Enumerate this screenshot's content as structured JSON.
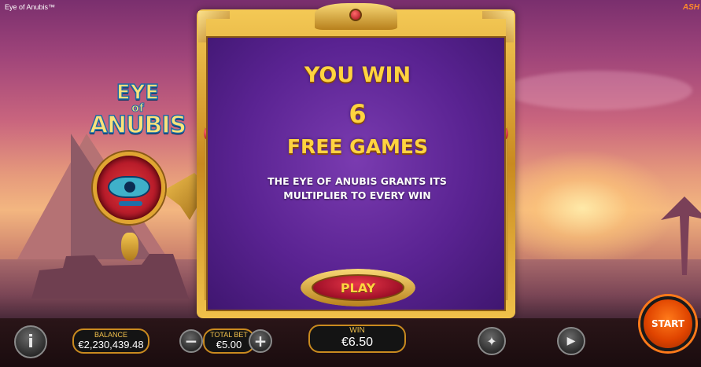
{
  "header": {
    "game_title": "Eye of Anubis™",
    "brand": "ASH"
  },
  "logo": {
    "line1": "EYE",
    "line2": "of",
    "line3": "ANUBIS",
    "trademark": "™"
  },
  "modal": {
    "title": "YOU WIN",
    "count": "6",
    "subtitle": "FREE GAMES",
    "description": "THE EYE OF ANUBIS GRANTS ITS MULTIPLIER TO EVERY WIN",
    "play_label": "PLAY"
  },
  "bottom_bar": {
    "info_icon": "i",
    "balance_label": "BALANCE",
    "balance_value": "€2,230,439.48",
    "minus_icon": "−",
    "total_bet_label": "TOTAL BET",
    "total_bet_value": "€5.00",
    "plus_icon": "+",
    "win_label": "WIN",
    "win_value": "€6.50",
    "turbo_icon": "✦",
    "autoplay_icon": "▶",
    "start_label": "START"
  },
  "colors": {
    "accent_gold": "#f1c04c",
    "modal_purple": "#5a2392",
    "start_orange": "#e04400"
  }
}
